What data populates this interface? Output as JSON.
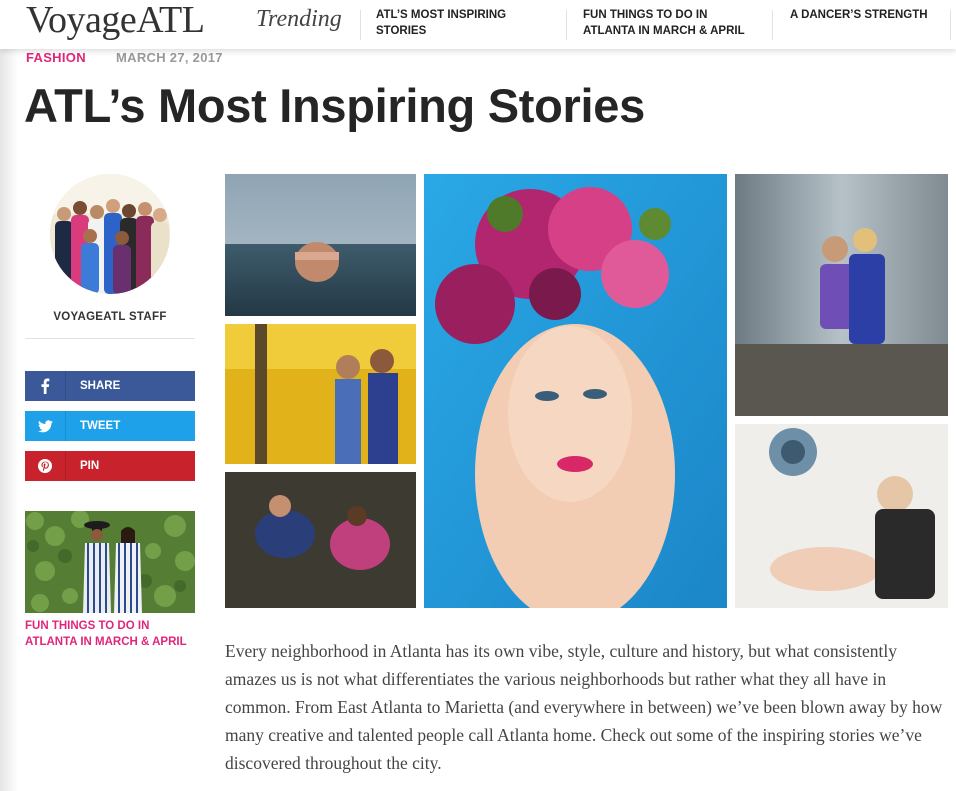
{
  "header": {
    "logo": "VoyageATL",
    "trending_label": "Trending",
    "nav": [
      "ATL’S MOST INSPIRING STORIES",
      "FUN THINGS TO DO IN ATLANTA IN MARCH & APRIL",
      "A DANCER’S STRENGTH"
    ]
  },
  "article": {
    "category": "FASHION",
    "date": "MARCH 27, 2017",
    "title": "ATL’s Most Inspiring Stories",
    "author": "VOYAGEATL STAFF",
    "body": "Every neighborhood in Atlanta has its own vibe, style, culture and history, but what consistently amazes us is not what differentiates the various neighborhoods but rather what they all have in common.  From East Atlanta to Marietta (and everywhere in between) we’ve been blown away by how many creative and talented people call Atlanta home.  Check out some of the inspiring stories we’ve discovered throughout the city."
  },
  "share": {
    "facebook": "SHARE",
    "twitter": "TWEET",
    "pinterest": "PIN"
  },
  "related": {
    "caption": "FUN THINGS TO DO IN ATLANTA IN MARCH & APRIL"
  },
  "colors": {
    "accent": "#e0267a",
    "facebook": "#3b5998",
    "twitter": "#1ea1e8",
    "pinterest": "#c8232c"
  },
  "icons": [
    "facebook-icon",
    "twitter-icon",
    "pinterest-icon"
  ]
}
